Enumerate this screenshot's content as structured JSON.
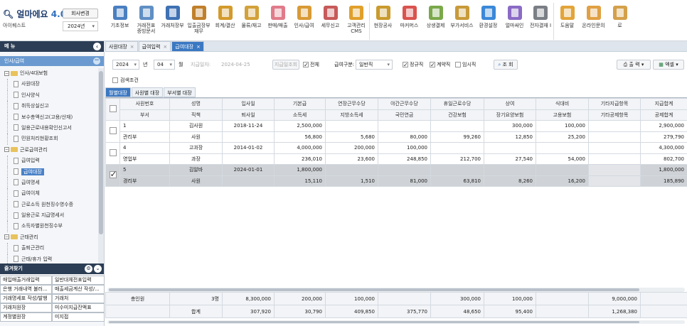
{
  "app": {
    "logo_text": "얼마에요",
    "version": "4.0",
    "company_name": "아이퀘스트",
    "company_change_label": "회사변경",
    "year_select": "2024년"
  },
  "menubar": [
    {
      "label": "기초정보",
      "icon": "ledger-icon",
      "color": "#4a7fc1"
    },
    {
      "label": "거래전표\n증빙문서",
      "icon": "voucher-icon",
      "color": "#5f8fc4"
    },
    {
      "label": "거래처장부",
      "icon": "book-icon",
      "color": "#3f71b3"
    },
    {
      "label": "입출금장부\n재무",
      "icon": "money-bag-icon",
      "color": "#c0802b"
    },
    {
      "label": "회계/결산",
      "icon": "document-icon",
      "color": "#d39a2c"
    },
    {
      "label": "물류/재고",
      "icon": "delivery-icon",
      "color": "#d2a139"
    },
    {
      "label": "판매/매출",
      "icon": "sales-icon",
      "color": "#e07b8a"
    },
    {
      "label": "인사/급여",
      "icon": "person-icon",
      "color": "#d89a35"
    },
    {
      "label": "세무신고",
      "icon": "tax-icon",
      "color": "#c75a5a"
    },
    {
      "label": "고객관리\nCMS",
      "icon": "customers-icon",
      "color": "#e0a02b"
    },
    {
      "label": "현장공사",
      "icon": "construction-icon",
      "color": "#c99a2e"
    },
    {
      "label": "마커머스",
      "icon": "store-icon",
      "color": "#d9534f"
    },
    {
      "label": "상생결제",
      "icon": "payment-icon",
      "color": "#7aa84a"
    },
    {
      "label": "부가서비스",
      "icon": "bank-icon",
      "color": "#c89a3a"
    },
    {
      "label": "환경설정",
      "icon": "gear-icon",
      "color": "#3b88d8"
    },
    {
      "label": "얼마싸인",
      "icon": "signature-icon",
      "color": "#8a6bc4"
    },
    {
      "label": "전자결재 I",
      "icon": "approval-icon",
      "color": "#7a7f86"
    },
    {
      "label": "도움말",
      "icon": "help-icon",
      "color": "#e2a43a"
    },
    {
      "label": "온라인문의",
      "icon": "support-icon",
      "color": "#e0a043"
    },
    {
      "label": "로",
      "icon": "logout-icon",
      "color": "#d4a04a"
    }
  ],
  "sidebar": {
    "title": "메 뉴",
    "group": "인사/급여",
    "tree": [
      {
        "label": "인사/4대보험",
        "level": 0,
        "folder": true
      },
      {
        "label": "사원대장",
        "level": 1
      },
      {
        "label": "인사양식",
        "level": 1
      },
      {
        "label": "취득상실신고",
        "level": 1
      },
      {
        "label": "보수총액신고(고용/산재)",
        "level": 1
      },
      {
        "label": "일용근로내용확인신고서",
        "level": 1
      },
      {
        "label": "민원처리현황조회",
        "level": 1
      },
      {
        "label": "근로급여관리",
        "level": 0,
        "folder": true
      },
      {
        "label": "급여입력",
        "level": 1
      },
      {
        "label": "급여대장",
        "level": 1,
        "active": true
      },
      {
        "label": "급여명세",
        "level": 1
      },
      {
        "label": "급여이체",
        "level": 1
      },
      {
        "label": "근로소득 원천징수영수증",
        "level": 1
      },
      {
        "label": "일용근로 지급명세서",
        "level": 1
      },
      {
        "label": "소득자별원천징수부",
        "level": 1
      },
      {
        "label": "근태관리",
        "level": 0,
        "folder": true
      },
      {
        "label": "출퇴근관리",
        "level": 1
      },
      {
        "label": "근태/휴가 입력",
        "level": 1
      }
    ],
    "favorites_title": "즐겨찾기",
    "favorites": [
      "매입매출거래입력",
      "일반대체전표입력",
      "은행 거래내역 불러...",
      "매출세금계산 작성/...",
      "거래명세표 작성/발행",
      "거래처",
      "거래처원장",
      "미수미지급잔액표",
      "계정별원장",
      "미지접"
    ]
  },
  "doc_tabs": [
    {
      "label": "사원대장",
      "active": false
    },
    {
      "label": "급여입력",
      "active": false
    },
    {
      "label": "급여대장",
      "active": true
    }
  ],
  "toolbar": {
    "year": "2024",
    "year_unit": "년",
    "month": "04",
    "month_unit": "월",
    "pay_date_label": "지급일자:",
    "pay_date": "2024-04-25",
    "pay_date_search": "지급일조회",
    "all_label": "전체",
    "pay_type_label": "급여구분:",
    "pay_type": "일반직",
    "regular_label": "정규직",
    "contract_label": "계약직",
    "temp_label": "임시직",
    "search_button": "조 회",
    "print_button": "출 력",
    "excel_button": "엑셀"
  },
  "search_condition": "검색조건",
  "sub_tabs": [
    {
      "label": "월별대장",
      "active": true
    },
    {
      "label": "사원별 대장",
      "active": false
    },
    {
      "label": "부서별 대장",
      "active": false
    }
  ],
  "grid": {
    "header1": [
      "사원번호",
      "성명",
      "입사일",
      "기본급",
      "연장근무수당",
      "야간근무수당",
      "휴일근로수당",
      "상여",
      "식대비",
      "기타지급항목",
      "지급합계"
    ],
    "header2": [
      "부서",
      "직책",
      "퇴사일",
      "소득세",
      "지방소득세",
      "국민연금",
      "건강보험",
      "장기요양보험",
      "고용보험",
      "기타공제항목",
      "공제합계"
    ],
    "rows": [
      {
        "checked": false,
        "line1": [
          "1",
          "김사원",
          "2018-11-24",
          "2,500,000",
          "",
          "",
          "",
          "300,000",
          "100,000",
          "",
          "2,900,000"
        ],
        "line2": [
          "관리부",
          "사원",
          "",
          "56,800",
          "5,680",
          "80,000",
          "99,260",
          "12,850",
          "25,200",
          "",
          "279,790"
        ]
      },
      {
        "checked": false,
        "line1": [
          "4",
          "고과장",
          "2014-01-02",
          "4,000,000",
          "200,000",
          "100,000",
          "",
          "",
          "",
          "",
          "4,300,000"
        ],
        "line2": [
          "영업부",
          "과장",
          "",
          "236,010",
          "23,600",
          "248,850",
          "212,700",
          "27,540",
          "54,000",
          "",
          "802,700"
        ]
      },
      {
        "checked": true,
        "line1": [
          "5",
          "김알바",
          "2024-01-01",
          "1,800,000",
          "",
          "",
          "",
          "",
          "",
          "",
          "1,800,000"
        ],
        "line2": [
          "경리부",
          "사원",
          "",
          "15,110",
          "1,510",
          "81,000",
          "63,810",
          "8,260",
          "16,200",
          "",
          "185,890"
        ]
      }
    ],
    "totals": {
      "line1": [
        "총인원",
        "3명",
        "8,300,000",
        "200,000",
        "100,000",
        "",
        "300,000",
        "100,000",
        "",
        "9,000,000"
      ],
      "line2": [
        "",
        "합계",
        "307,920",
        "30,790",
        "409,850",
        "375,770",
        "48,650",
        "95,400",
        "",
        "1,268,380"
      ]
    }
  }
}
